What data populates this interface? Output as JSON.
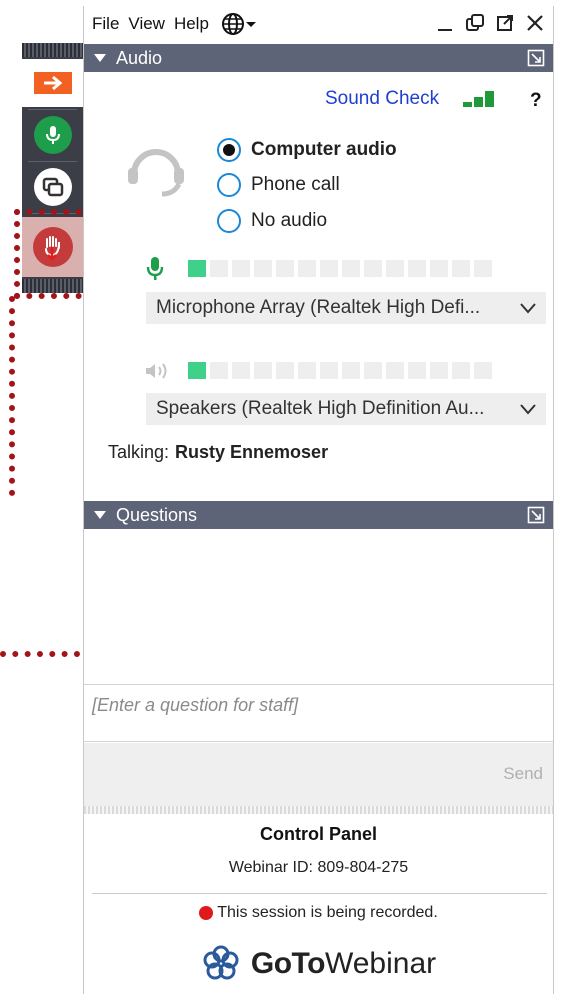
{
  "menu": {
    "file": "File",
    "view": "View",
    "help": "Help"
  },
  "icons": {
    "globe": "globe-icon",
    "minimize": "minimize-icon",
    "popout": "popout-icon",
    "maximize": "maximize-icon",
    "close": "close-icon",
    "toolbar": [
      "arrow-right-icon",
      "microphone-icon",
      "screen-share-icon",
      "raise-hand-icon"
    ]
  },
  "audio": {
    "header": "Audio",
    "sound_check": "Sound Check",
    "help": "?",
    "options": [
      {
        "label": "Computer audio",
        "selected": true
      },
      {
        "label": "Phone call",
        "selected": false
      },
      {
        "label": "No audio",
        "selected": false
      }
    ],
    "microphone": {
      "device": "Microphone Array (Realtek High Defi...",
      "level_segments_on": 1,
      "level_segments_total": 14
    },
    "speakers": {
      "device": "Speakers (Realtek High Definition Au...",
      "level_segments_on": 1,
      "level_segments_total": 14
    },
    "talking_label": "Talking:",
    "talking_name": "Rusty Ennemoser"
  },
  "questions": {
    "header": "Questions",
    "placeholder": "[Enter a question for staff]",
    "send": "Send"
  },
  "footer": {
    "title": "Control Panel",
    "webinar_id": "Webinar ID: 809-804-275",
    "recording": "This session is being recorded.",
    "brand_bold": "GoTo",
    "brand_light": "Webinar"
  },
  "colors": {
    "section_header": "#5e6478",
    "link": "#1f3fd1",
    "signal": "#1f9a3a",
    "meter_on": "#3fd08a",
    "toolbar_arrow": "#f26122",
    "mic_green": "#1e9e4a",
    "annotation": "#a3131a",
    "record_dot": "#e0191c"
  }
}
